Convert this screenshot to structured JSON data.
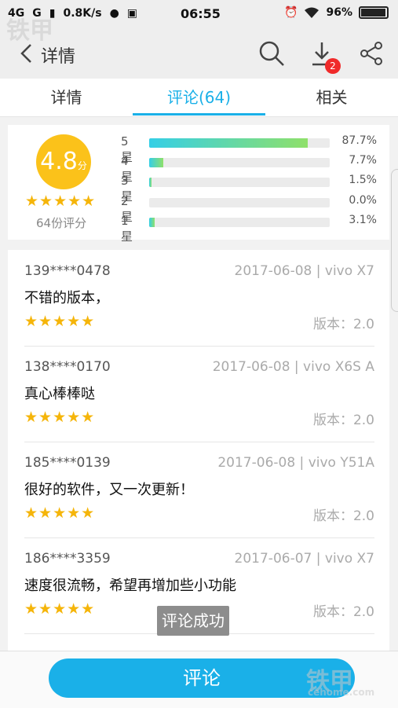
{
  "status": {
    "network": "4G",
    "signal_label": "G",
    "speed": "0.8K/s",
    "time": "06:55",
    "battery": "96%",
    "battery_fraction": 0.96
  },
  "header": {
    "title": "详情",
    "download_badge": "2"
  },
  "tabs": [
    {
      "label": "详情"
    },
    {
      "label": "评论(64)"
    },
    {
      "label": "相关"
    }
  ],
  "rating": {
    "score": "4.8",
    "score_unit": "分",
    "stars": "★★★★★",
    "count": "64份评分",
    "distribution": [
      {
        "label": "5星",
        "pct": "87.7%",
        "fraction": 0.877
      },
      {
        "label": "4星",
        "pct": "7.7%",
        "fraction": 0.077
      },
      {
        "label": "3星",
        "pct": "1.5%",
        "fraction": 0.015
      },
      {
        "label": "2星",
        "pct": "0.0%",
        "fraction": 0.0
      },
      {
        "label": "1星",
        "pct": "3.1%",
        "fraction": 0.031
      }
    ]
  },
  "reviews": [
    {
      "user": "139****0478",
      "meta": "2017-06-08 | vivo X7",
      "text": "不错的版本，",
      "stars": "★★★★★",
      "version": "版本：2.0"
    },
    {
      "user": "138****0170",
      "meta": "2017-06-08 | vivo X6S A",
      "text": "真心棒棒哒",
      "stars": "★★★★★",
      "version": "版本：2.0"
    },
    {
      "user": "185****0139",
      "meta": "2017-06-08 | vivo Y51A",
      "text": "很好的软件，又一次更新！",
      "stars": "★★★★★",
      "version": "版本：2.0"
    },
    {
      "user": "186****3359",
      "meta": "2017-06-07 | vivo X7",
      "text": "速度很流畅，希望再增加些小功能",
      "stars": "★★★★★",
      "version": "版本：2.0"
    }
  ],
  "toast": "评论成功",
  "bottom": {
    "comment_button": "评论"
  },
  "watermark": {
    "brand": "铁甲",
    "site": "cehome.com"
  },
  "colors": {
    "accent": "#1ab0e8",
    "star": "#f5b50a",
    "score_badge": "#fbc21a",
    "badge": "#f02a2a"
  }
}
